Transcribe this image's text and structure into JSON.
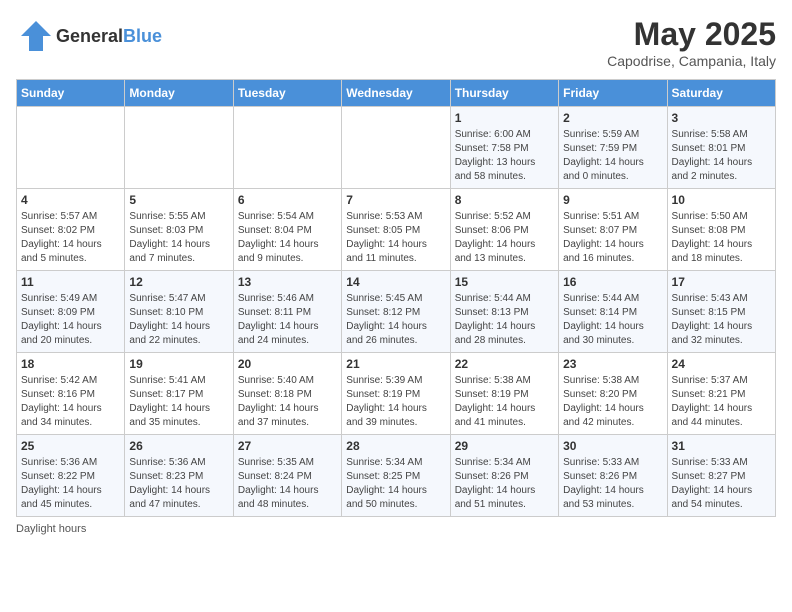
{
  "header": {
    "logo_general": "General",
    "logo_blue": "Blue",
    "month": "May 2025",
    "location": "Capodrise, Campania, Italy"
  },
  "days_of_week": [
    "Sunday",
    "Monday",
    "Tuesday",
    "Wednesday",
    "Thursday",
    "Friday",
    "Saturday"
  ],
  "weeks": [
    [
      {
        "day": "",
        "info": ""
      },
      {
        "day": "",
        "info": ""
      },
      {
        "day": "",
        "info": ""
      },
      {
        "day": "",
        "info": ""
      },
      {
        "day": "1",
        "info": "Sunrise: 6:00 AM\nSunset: 7:58 PM\nDaylight: 13 hours and 58 minutes."
      },
      {
        "day": "2",
        "info": "Sunrise: 5:59 AM\nSunset: 7:59 PM\nDaylight: 14 hours and 0 minutes."
      },
      {
        "day": "3",
        "info": "Sunrise: 5:58 AM\nSunset: 8:01 PM\nDaylight: 14 hours and 2 minutes."
      }
    ],
    [
      {
        "day": "4",
        "info": "Sunrise: 5:57 AM\nSunset: 8:02 PM\nDaylight: 14 hours and 5 minutes."
      },
      {
        "day": "5",
        "info": "Sunrise: 5:55 AM\nSunset: 8:03 PM\nDaylight: 14 hours and 7 minutes."
      },
      {
        "day": "6",
        "info": "Sunrise: 5:54 AM\nSunset: 8:04 PM\nDaylight: 14 hours and 9 minutes."
      },
      {
        "day": "7",
        "info": "Sunrise: 5:53 AM\nSunset: 8:05 PM\nDaylight: 14 hours and 11 minutes."
      },
      {
        "day": "8",
        "info": "Sunrise: 5:52 AM\nSunset: 8:06 PM\nDaylight: 14 hours and 13 minutes."
      },
      {
        "day": "9",
        "info": "Sunrise: 5:51 AM\nSunset: 8:07 PM\nDaylight: 14 hours and 16 minutes."
      },
      {
        "day": "10",
        "info": "Sunrise: 5:50 AM\nSunset: 8:08 PM\nDaylight: 14 hours and 18 minutes."
      }
    ],
    [
      {
        "day": "11",
        "info": "Sunrise: 5:49 AM\nSunset: 8:09 PM\nDaylight: 14 hours and 20 minutes."
      },
      {
        "day": "12",
        "info": "Sunrise: 5:47 AM\nSunset: 8:10 PM\nDaylight: 14 hours and 22 minutes."
      },
      {
        "day": "13",
        "info": "Sunrise: 5:46 AM\nSunset: 8:11 PM\nDaylight: 14 hours and 24 minutes."
      },
      {
        "day": "14",
        "info": "Sunrise: 5:45 AM\nSunset: 8:12 PM\nDaylight: 14 hours and 26 minutes."
      },
      {
        "day": "15",
        "info": "Sunrise: 5:44 AM\nSunset: 8:13 PM\nDaylight: 14 hours and 28 minutes."
      },
      {
        "day": "16",
        "info": "Sunrise: 5:44 AM\nSunset: 8:14 PM\nDaylight: 14 hours and 30 minutes."
      },
      {
        "day": "17",
        "info": "Sunrise: 5:43 AM\nSunset: 8:15 PM\nDaylight: 14 hours and 32 minutes."
      }
    ],
    [
      {
        "day": "18",
        "info": "Sunrise: 5:42 AM\nSunset: 8:16 PM\nDaylight: 14 hours and 34 minutes."
      },
      {
        "day": "19",
        "info": "Sunrise: 5:41 AM\nSunset: 8:17 PM\nDaylight: 14 hours and 35 minutes."
      },
      {
        "day": "20",
        "info": "Sunrise: 5:40 AM\nSunset: 8:18 PM\nDaylight: 14 hours and 37 minutes."
      },
      {
        "day": "21",
        "info": "Sunrise: 5:39 AM\nSunset: 8:19 PM\nDaylight: 14 hours and 39 minutes."
      },
      {
        "day": "22",
        "info": "Sunrise: 5:38 AM\nSunset: 8:19 PM\nDaylight: 14 hours and 41 minutes."
      },
      {
        "day": "23",
        "info": "Sunrise: 5:38 AM\nSunset: 8:20 PM\nDaylight: 14 hours and 42 minutes."
      },
      {
        "day": "24",
        "info": "Sunrise: 5:37 AM\nSunset: 8:21 PM\nDaylight: 14 hours and 44 minutes."
      }
    ],
    [
      {
        "day": "25",
        "info": "Sunrise: 5:36 AM\nSunset: 8:22 PM\nDaylight: 14 hours and 45 minutes."
      },
      {
        "day": "26",
        "info": "Sunrise: 5:36 AM\nSunset: 8:23 PM\nDaylight: 14 hours and 47 minutes."
      },
      {
        "day": "27",
        "info": "Sunrise: 5:35 AM\nSunset: 8:24 PM\nDaylight: 14 hours and 48 minutes."
      },
      {
        "day": "28",
        "info": "Sunrise: 5:34 AM\nSunset: 8:25 PM\nDaylight: 14 hours and 50 minutes."
      },
      {
        "day": "29",
        "info": "Sunrise: 5:34 AM\nSunset: 8:26 PM\nDaylight: 14 hours and 51 minutes."
      },
      {
        "day": "30",
        "info": "Sunrise: 5:33 AM\nSunset: 8:26 PM\nDaylight: 14 hours and 53 minutes."
      },
      {
        "day": "31",
        "info": "Sunrise: 5:33 AM\nSunset: 8:27 PM\nDaylight: 14 hours and 54 minutes."
      }
    ]
  ],
  "footer": {
    "note": "Daylight hours"
  }
}
